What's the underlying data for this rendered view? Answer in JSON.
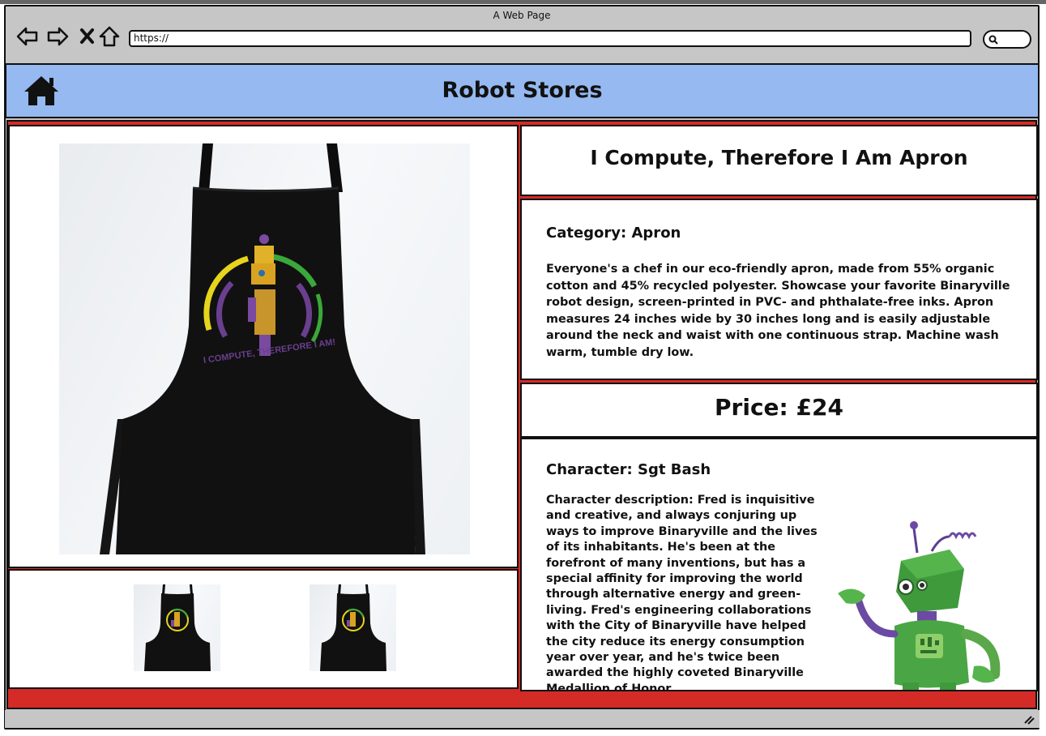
{
  "window": {
    "title": "A Web Page",
    "url": "https://"
  },
  "header": {
    "site_title": "Robot Stores"
  },
  "product": {
    "title": "I Compute, Therefore I Am Apron",
    "category": "Category: Apron",
    "description": "Everyone's a chef in our eco-friendly apron, made from 55% organic cotton and 45% recycled polyester. Showcase your favorite Binaryville robot design, screen-printed in PVC- and phthalate-free inks. Apron measures 24 inches wide by 30 inches long and is easily adjustable around the neck and waist with one continuous strap. Machine wash warm, tumble dry low.",
    "price": "Price: £24",
    "print_text": "I COMPUTE, THEREFORE I AM!"
  },
  "character": {
    "name": "Character: Sgt Bash",
    "description": "Character description: Fred is inquisitive and creative, and always conjuring up ways to improve Binaryville and the lives of its inhabitants. He's been at the forefront of many inventions, but has a special affinity for improving the world through alternative energy and green-living. Fred's engineering collaborations with the City of Binaryville have helped the city reduce its energy consumption year over year, and he's twice been awarded the highly coveted Binaryville Medallion of Honor."
  },
  "icons": {
    "back": "arrow-left-icon",
    "forward": "arrow-right-icon",
    "stop": "close-icon",
    "home_nav": "home-icon",
    "search": "search-icon",
    "site_home": "home-icon"
  },
  "colors": {
    "header_bg": "#95b9f0",
    "accent_red": "#d42b27",
    "chrome_gray": "#c6c6c6"
  }
}
